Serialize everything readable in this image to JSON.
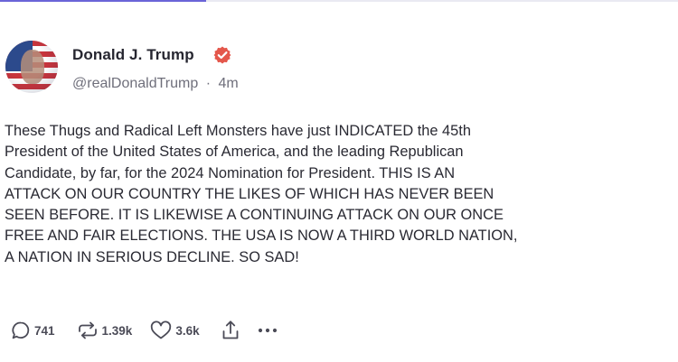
{
  "post": {
    "author": {
      "display_name": "Donald J. Trump",
      "handle": "@realDonaldTrump",
      "separator": "·",
      "time_ago": "4m",
      "verified_badge_color": "#e4574b",
      "avatar_icon": "avatar-image"
    },
    "body": "These Thugs and Radical Left Monsters have just INDICATED the 45th\nPresident of the United States of America, and the leading Republican\nCandidate, by far, for the 2024 Nomination for President. THIS IS AN\nATTACK ON OUR COUNTRY THE LIKES OF WHICH HAS NEVER BEEN\nSEEN BEFORE. IT IS LIKEWISE A CONTINUING ATTACK ON OUR ONCE\nFREE AND FAIR ELECTIONS. THE USA IS NOW A THIRD WORLD NATION,\nA NATION IN SERIOUS DECLINE. SO SAD!",
    "actions": {
      "reply": {
        "icon": "reply-icon",
        "count": "741"
      },
      "retruth": {
        "icon": "retruth-icon",
        "count": "1.39k"
      },
      "like": {
        "icon": "heart-icon",
        "count": "3.6k"
      },
      "share": {
        "icon": "share-icon"
      },
      "more": {
        "icon": "more-icon"
      }
    }
  },
  "colors": {
    "accent": "#6a64d8",
    "text": "#2a2a33",
    "muted": "#6f6f7b",
    "icon": "#4b4b57"
  }
}
